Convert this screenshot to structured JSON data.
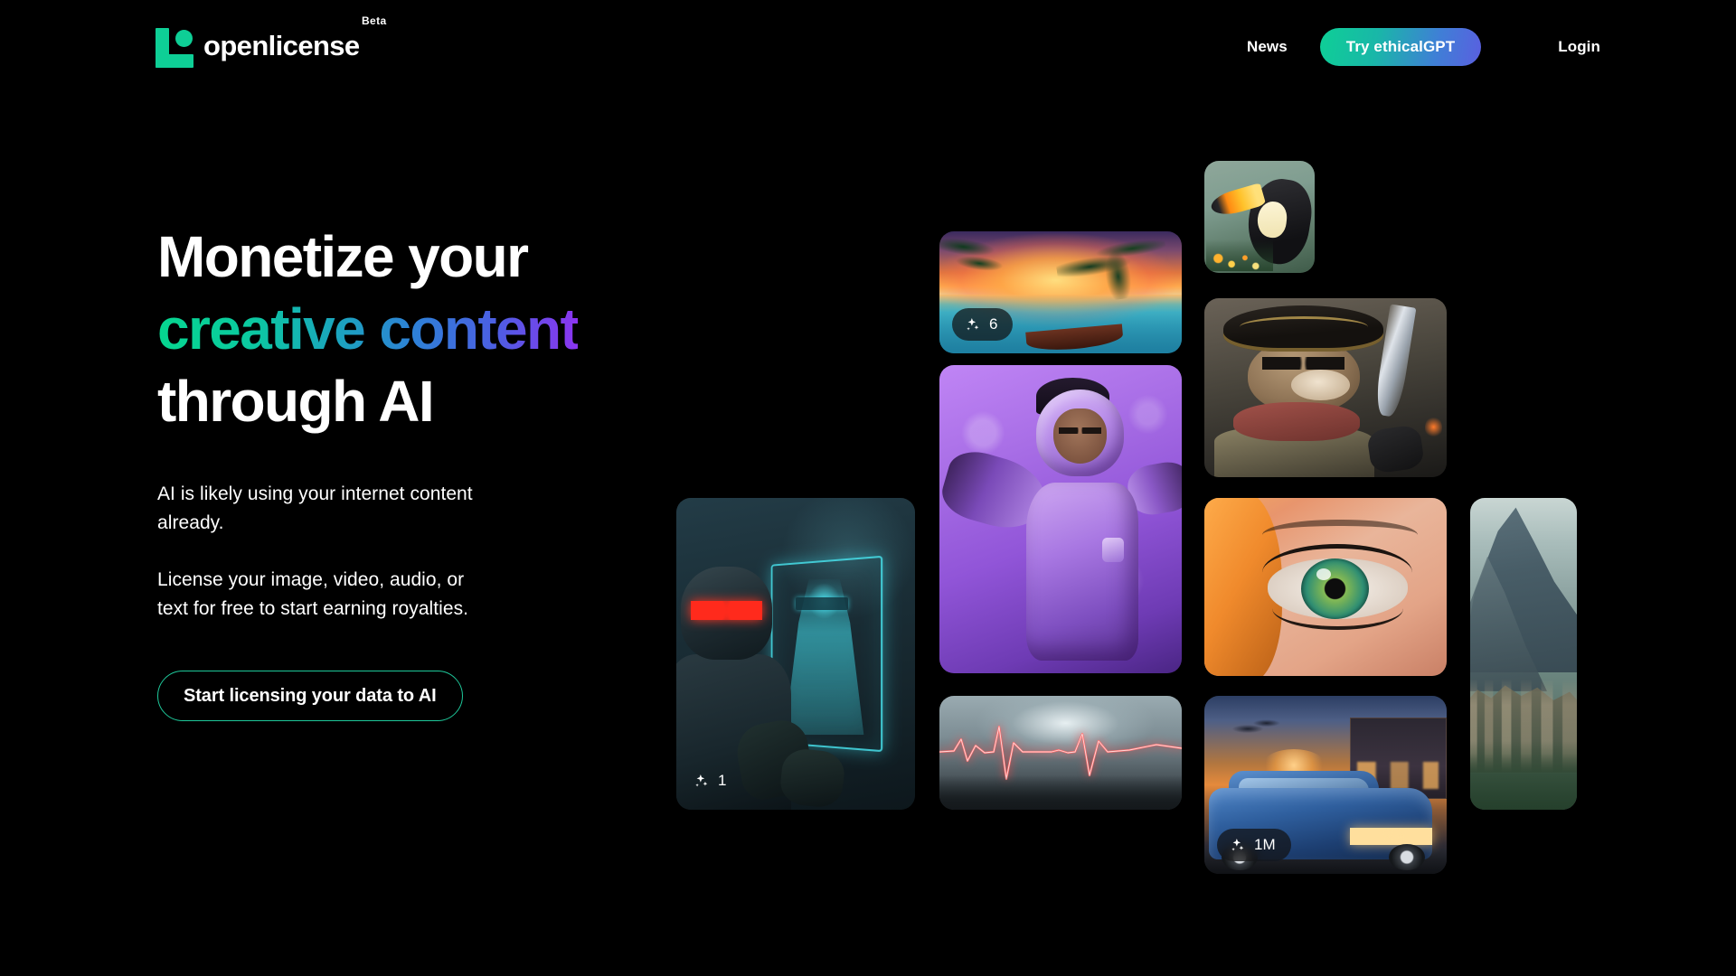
{
  "brand": {
    "name": "openlicense",
    "badge": "Beta",
    "logo_icon": "openlicense-logo-mark",
    "accent_color": "#0ecf96"
  },
  "nav": {
    "news_label": "News",
    "cta_label": "Try ethicalGPT",
    "login_label": "Login",
    "cta_gradient_from": "#0ecf96",
    "cta_gradient_to": "#5a5fe0"
  },
  "hero": {
    "headline_line1": "Monetize your",
    "headline_line2_gradient": "creative content",
    "headline_line3": "through AI",
    "paragraph1": "AI is likely using your internet content already.",
    "paragraph2": "License your image, video, audio, or text for free to start earning royalties.",
    "cta_label": "Start licensing your data to AI",
    "cta_border_color": "#1ec89a",
    "gradient_stops": [
      "#06d68f",
      "#1aa6bd",
      "#2f7fd8",
      "#8b35f0"
    ]
  },
  "gallery": {
    "badge_icon": "sparkles-icon",
    "items": [
      {
        "name": "beach-sunset",
        "badge": "6",
        "has_badge": true
      },
      {
        "name": "toucan-bird",
        "badge": "",
        "has_badge": false
      },
      {
        "name": "pirate-otter",
        "badge": "",
        "has_badge": false
      },
      {
        "name": "purple-astronaut",
        "badge": "",
        "has_badge": false
      },
      {
        "name": "green-eye",
        "badge": "",
        "has_badge": false
      },
      {
        "name": "cyber-soldier-hologram",
        "badge": "1",
        "has_badge": true
      },
      {
        "name": "ecg-heartbeat",
        "badge": "",
        "has_badge": false
      },
      {
        "name": "blue-lowrider-car",
        "badge": "1M",
        "has_badge": true
      },
      {
        "name": "mountain-village",
        "badge": "",
        "has_badge": false
      }
    ]
  }
}
